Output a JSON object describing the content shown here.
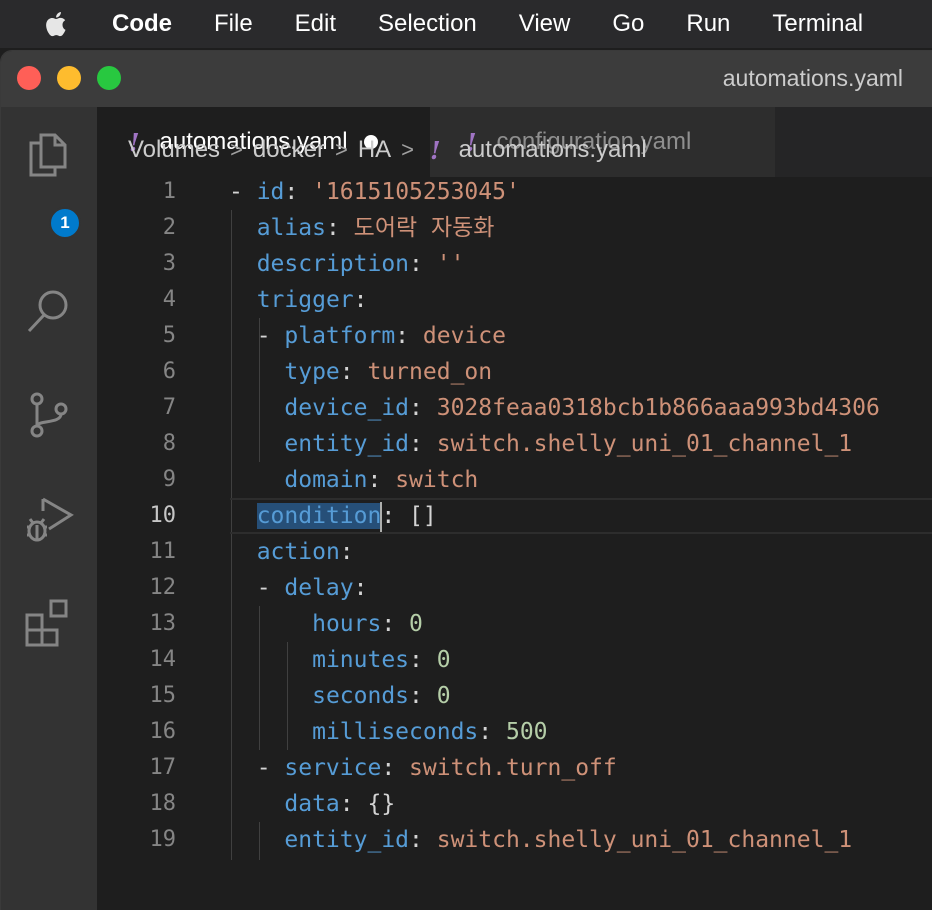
{
  "menubar": {
    "app": "Code",
    "items": [
      "File",
      "Edit",
      "Selection",
      "View",
      "Go",
      "Run",
      "Terminal"
    ]
  },
  "window": {
    "title": "automations.yaml"
  },
  "activity_bar": {
    "icons": [
      "explorer-icon",
      "search-icon",
      "source-control-icon",
      "run-debug-icon",
      "extensions-icon"
    ],
    "explorer_badge": "1"
  },
  "tabs": [
    {
      "label": "automations.yaml",
      "icon": "!",
      "dirty": true,
      "active": true
    },
    {
      "label": "configuration.yaml",
      "icon": "!",
      "dirty": false,
      "active": false
    }
  ],
  "breadcrumb": {
    "parts": [
      "Volumes",
      "docker",
      "HA"
    ],
    "file_icon": "!",
    "file": "automations.yaml",
    "separator": ">"
  },
  "editor": {
    "current_line": 10,
    "selected_word": "condition",
    "lines": [
      {
        "n": "1",
        "tokens": [
          [
            "p",
            "- "
          ],
          [
            "k",
            "id"
          ],
          [
            "p",
            ": "
          ],
          [
            "s",
            "'1615105253045'"
          ]
        ]
      },
      {
        "n": "2",
        "tokens": [
          [
            "p",
            "  "
          ],
          [
            "k",
            "alias"
          ],
          [
            "p",
            ": "
          ],
          [
            "s",
            "도어락 자동화"
          ]
        ]
      },
      {
        "n": "3",
        "tokens": [
          [
            "p",
            "  "
          ],
          [
            "k",
            "description"
          ],
          [
            "p",
            ": "
          ],
          [
            "s",
            "''"
          ]
        ]
      },
      {
        "n": "4",
        "tokens": [
          [
            "p",
            "  "
          ],
          [
            "k",
            "trigger"
          ],
          [
            "p",
            ":"
          ]
        ]
      },
      {
        "n": "5",
        "tokens": [
          [
            "p",
            "  - "
          ],
          [
            "k",
            "platform"
          ],
          [
            "p",
            ": "
          ],
          [
            "s",
            "device"
          ]
        ]
      },
      {
        "n": "6",
        "tokens": [
          [
            "p",
            "    "
          ],
          [
            "k",
            "type"
          ],
          [
            "p",
            ": "
          ],
          [
            "s",
            "turned_on"
          ]
        ]
      },
      {
        "n": "7",
        "tokens": [
          [
            "p",
            "    "
          ],
          [
            "k",
            "device_id"
          ],
          [
            "p",
            ": "
          ],
          [
            "s",
            "3028feaa0318bcb1b866aaa993bd4306"
          ]
        ]
      },
      {
        "n": "8",
        "tokens": [
          [
            "p",
            "    "
          ],
          [
            "k",
            "entity_id"
          ],
          [
            "p",
            ": "
          ],
          [
            "s",
            "switch.shelly_uni_01_channel_1"
          ]
        ]
      },
      {
        "n": "9",
        "tokens": [
          [
            "p",
            "    "
          ],
          [
            "k",
            "domain"
          ],
          [
            "p",
            ": "
          ],
          [
            "s",
            "switch"
          ]
        ]
      },
      {
        "n": "10",
        "tokens": [
          [
            "p",
            "  "
          ],
          [
            "sel",
            "condition"
          ],
          [
            "cursor",
            ""
          ],
          [
            "p",
            ": []"
          ]
        ]
      },
      {
        "n": "11",
        "tokens": [
          [
            "p",
            "  "
          ],
          [
            "k",
            "action"
          ],
          [
            "p",
            ":"
          ]
        ]
      },
      {
        "n": "12",
        "tokens": [
          [
            "p",
            "  - "
          ],
          [
            "k",
            "delay"
          ],
          [
            "p",
            ":"
          ]
        ]
      },
      {
        "n": "13",
        "tokens": [
          [
            "p",
            "      "
          ],
          [
            "k",
            "hours"
          ],
          [
            "p",
            ": "
          ],
          [
            "n",
            "0"
          ]
        ]
      },
      {
        "n": "14",
        "tokens": [
          [
            "p",
            "      "
          ],
          [
            "k",
            "minutes"
          ],
          [
            "p",
            ": "
          ],
          [
            "n",
            "0"
          ]
        ]
      },
      {
        "n": "15",
        "tokens": [
          [
            "p",
            "      "
          ],
          [
            "k",
            "seconds"
          ],
          [
            "p",
            ": "
          ],
          [
            "n",
            "0"
          ]
        ]
      },
      {
        "n": "16",
        "tokens": [
          [
            "p",
            "      "
          ],
          [
            "k",
            "milliseconds"
          ],
          [
            "p",
            ": "
          ],
          [
            "n",
            "500"
          ]
        ]
      },
      {
        "n": "17",
        "tokens": [
          [
            "p",
            "  - "
          ],
          [
            "k",
            "service"
          ],
          [
            "p",
            ": "
          ],
          [
            "s",
            "switch.turn_off"
          ]
        ]
      },
      {
        "n": "18",
        "tokens": [
          [
            "p",
            "    "
          ],
          [
            "k",
            "data"
          ],
          [
            "p",
            ": {}"
          ]
        ]
      },
      {
        "n": "19",
        "tokens": [
          [
            "p",
            "    "
          ],
          [
            "k",
            "entity_id"
          ],
          [
            "p",
            ": "
          ],
          [
            "s",
            "switch.shelly_uni_01_channel_1"
          ]
        ]
      }
    ]
  }
}
